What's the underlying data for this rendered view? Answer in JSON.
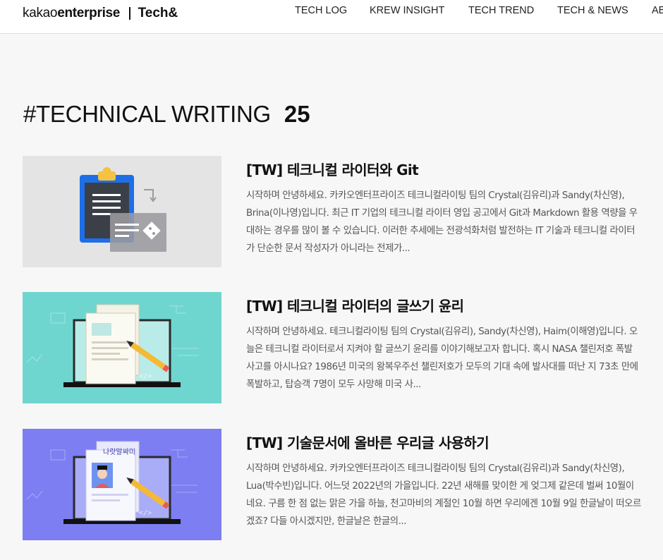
{
  "header": {
    "logo_kakao_light": "kakao",
    "logo_kakao_bold": "enterprise",
    "logo_tech": "Tech&",
    "nav": [
      "TECH LOG",
      "KREW INSIGHT",
      "TECH TREND",
      "TECH & NEWS",
      "AB"
    ]
  },
  "page": {
    "tag": "#TECHNICAL WRITING",
    "count": "25"
  },
  "articles": [
    {
      "title": "[TW] 테크니컬 라이터와 Git",
      "excerpt": "시작하며 안녕하세요. 카카오엔터프라이즈 테크니컬라이팅 팀의 Crystal(김유리)과 Sandy(차신영), Brina(이나영)입니다. 최근 IT 기업의 테크니컬 라이터 영입 공고에서 Git과 Markdown 활용 역량을 우대하는 경우를 많이 볼 수 있습니다. 이러한 추세에는 전광석화처럼 발전하는 IT 기술과 테크니컬 라이터가 단순한 문서 작성자가 아니라는 전제가...",
      "thumb_bg": "#e4e4e4"
    },
    {
      "title": "[TW] 테크니컬 라이터의 글쓰기 윤리",
      "excerpt": "시작하며 안녕하세요. 테크니컬라이팅 팀의 Crystal(김유리), Sandy(차신영), Haim(이해영)입니다. 오늘은 테크니컬 라이터로서 지켜야 할 글쓰기 윤리를 이야기해보고자 합니다. 혹시 NASA 챌린저호 폭발 사고를 아시나요? 1986년 미국의 왕복우주선 챌린저호가 모두의 기대 속에 발사대를 떠난 지 73초 만에 폭발하고, 탑승객 7명이 모두 사망해 미국 사...",
      "thumb_bg": "#6fd6cf"
    },
    {
      "title": "[TW] 기술문서에 올바른 우리글 사용하기",
      "excerpt": "시작하며 안녕하세요. 카카오엔터프라이즈 테크니컬라이팅 팀의 Crystal(김유리)과 Sandy(차신영), Lua(박수빈)입니다. 어느덧 2022년의 가을입니다. 22년 새해를 맞이한 게 엊그제 같은데 벌써 10월이네요. 구름 한 점 없는 맑은 가을 하늘, 천고마비의 계절인 10월 하면 우리에겐 10월 9일 한글날이 떠오르겠죠? 다들 아시겠지만, 한글날은 한글의...",
      "thumb_bg": "#7c7ef2",
      "thumb_text": "나랏말싸미"
    }
  ]
}
